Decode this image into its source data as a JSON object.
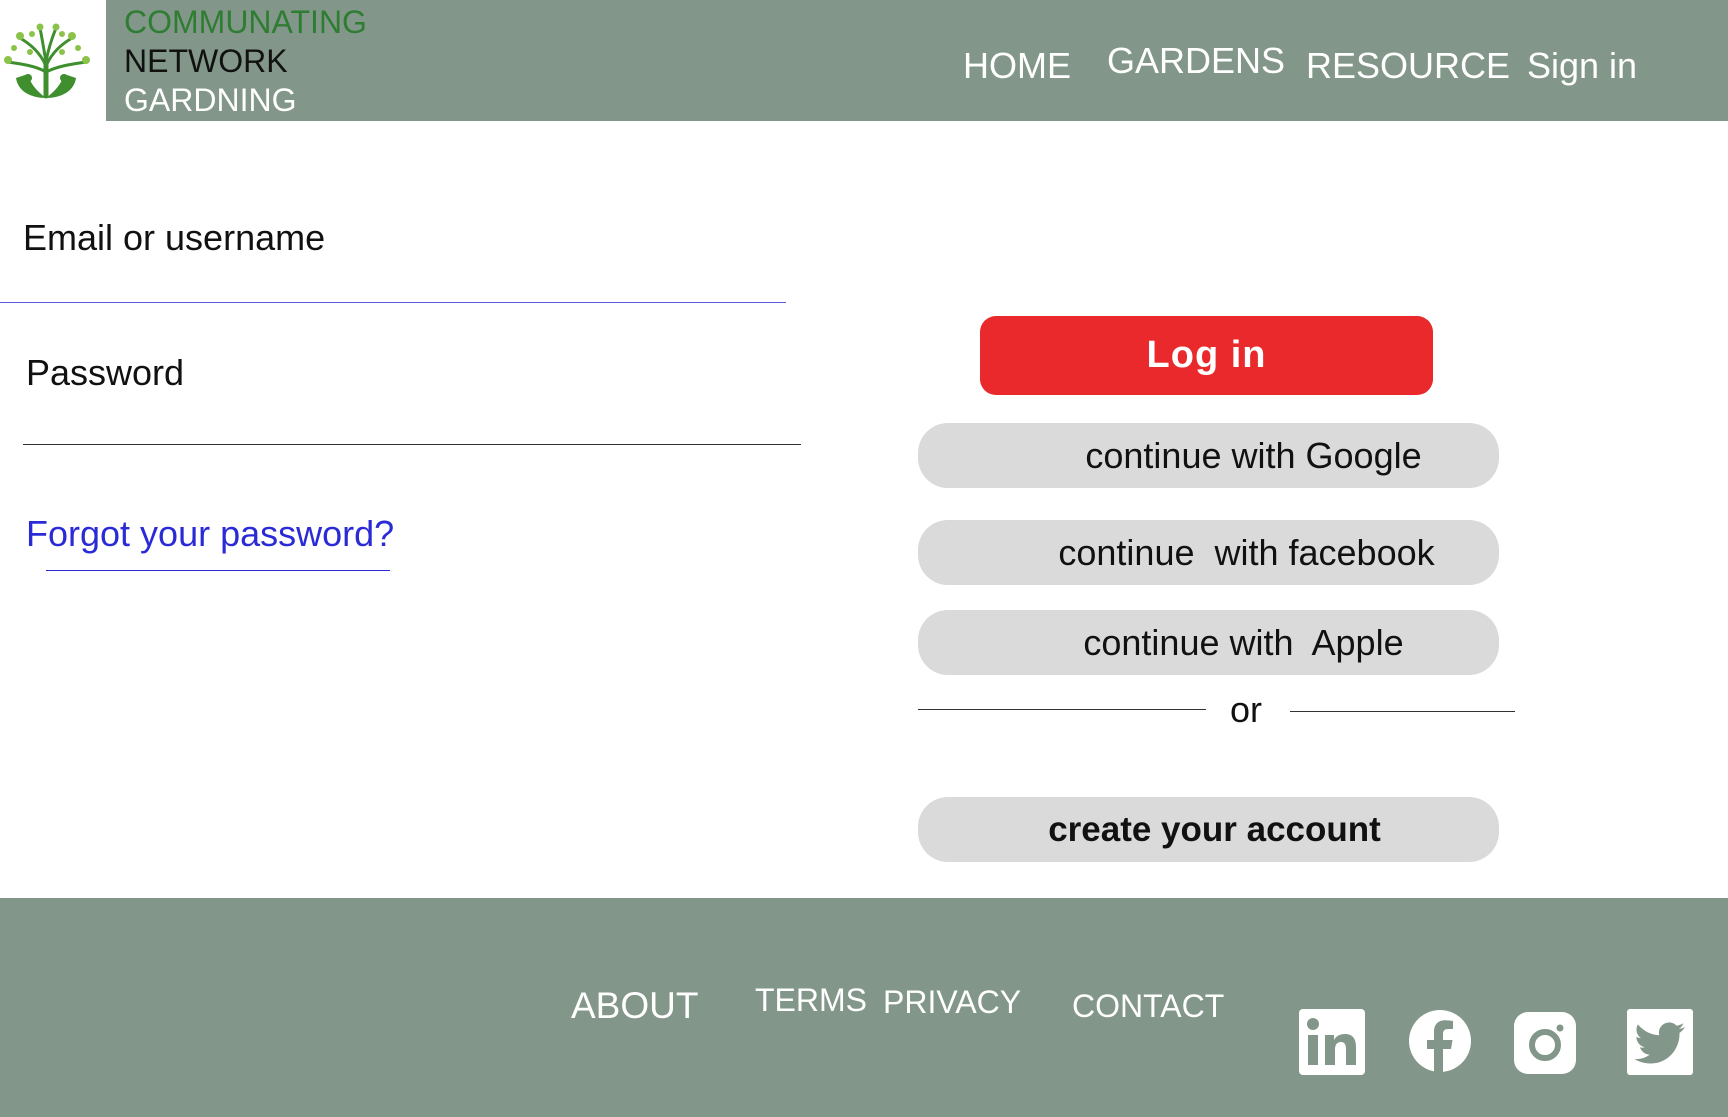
{
  "header": {
    "brand": {
      "line1": "COMMUNATING",
      "line2": "NETWORK",
      "line3": "GARDNING",
      "logo_icon": "tree-hands-logo-icon"
    },
    "nav": {
      "home": "HOME",
      "gardens": "GARDENS",
      "resource": "RESOURCE",
      "sign_in": "Sign in"
    },
    "background_color": "#829789"
  },
  "form": {
    "email_label": "Email or username",
    "email_value": "",
    "password_label": "Password",
    "password_value": "",
    "forgot_link": "Forgot your password?"
  },
  "actions": {
    "login": "Log in",
    "login_color": "#e9292b",
    "google": "continue with Google",
    "facebook": "continue  with facebook",
    "apple": "continue with  Apple",
    "or": "or",
    "create_account": "create your account"
  },
  "footer": {
    "about": "ABOUT",
    "terms": "TERMS",
    "privacy": "PRIVACY",
    "contact": "CONTACT",
    "social_icons": [
      "linkedin-icon",
      "facebook-icon",
      "instagram-icon",
      "twitter-icon"
    ]
  }
}
